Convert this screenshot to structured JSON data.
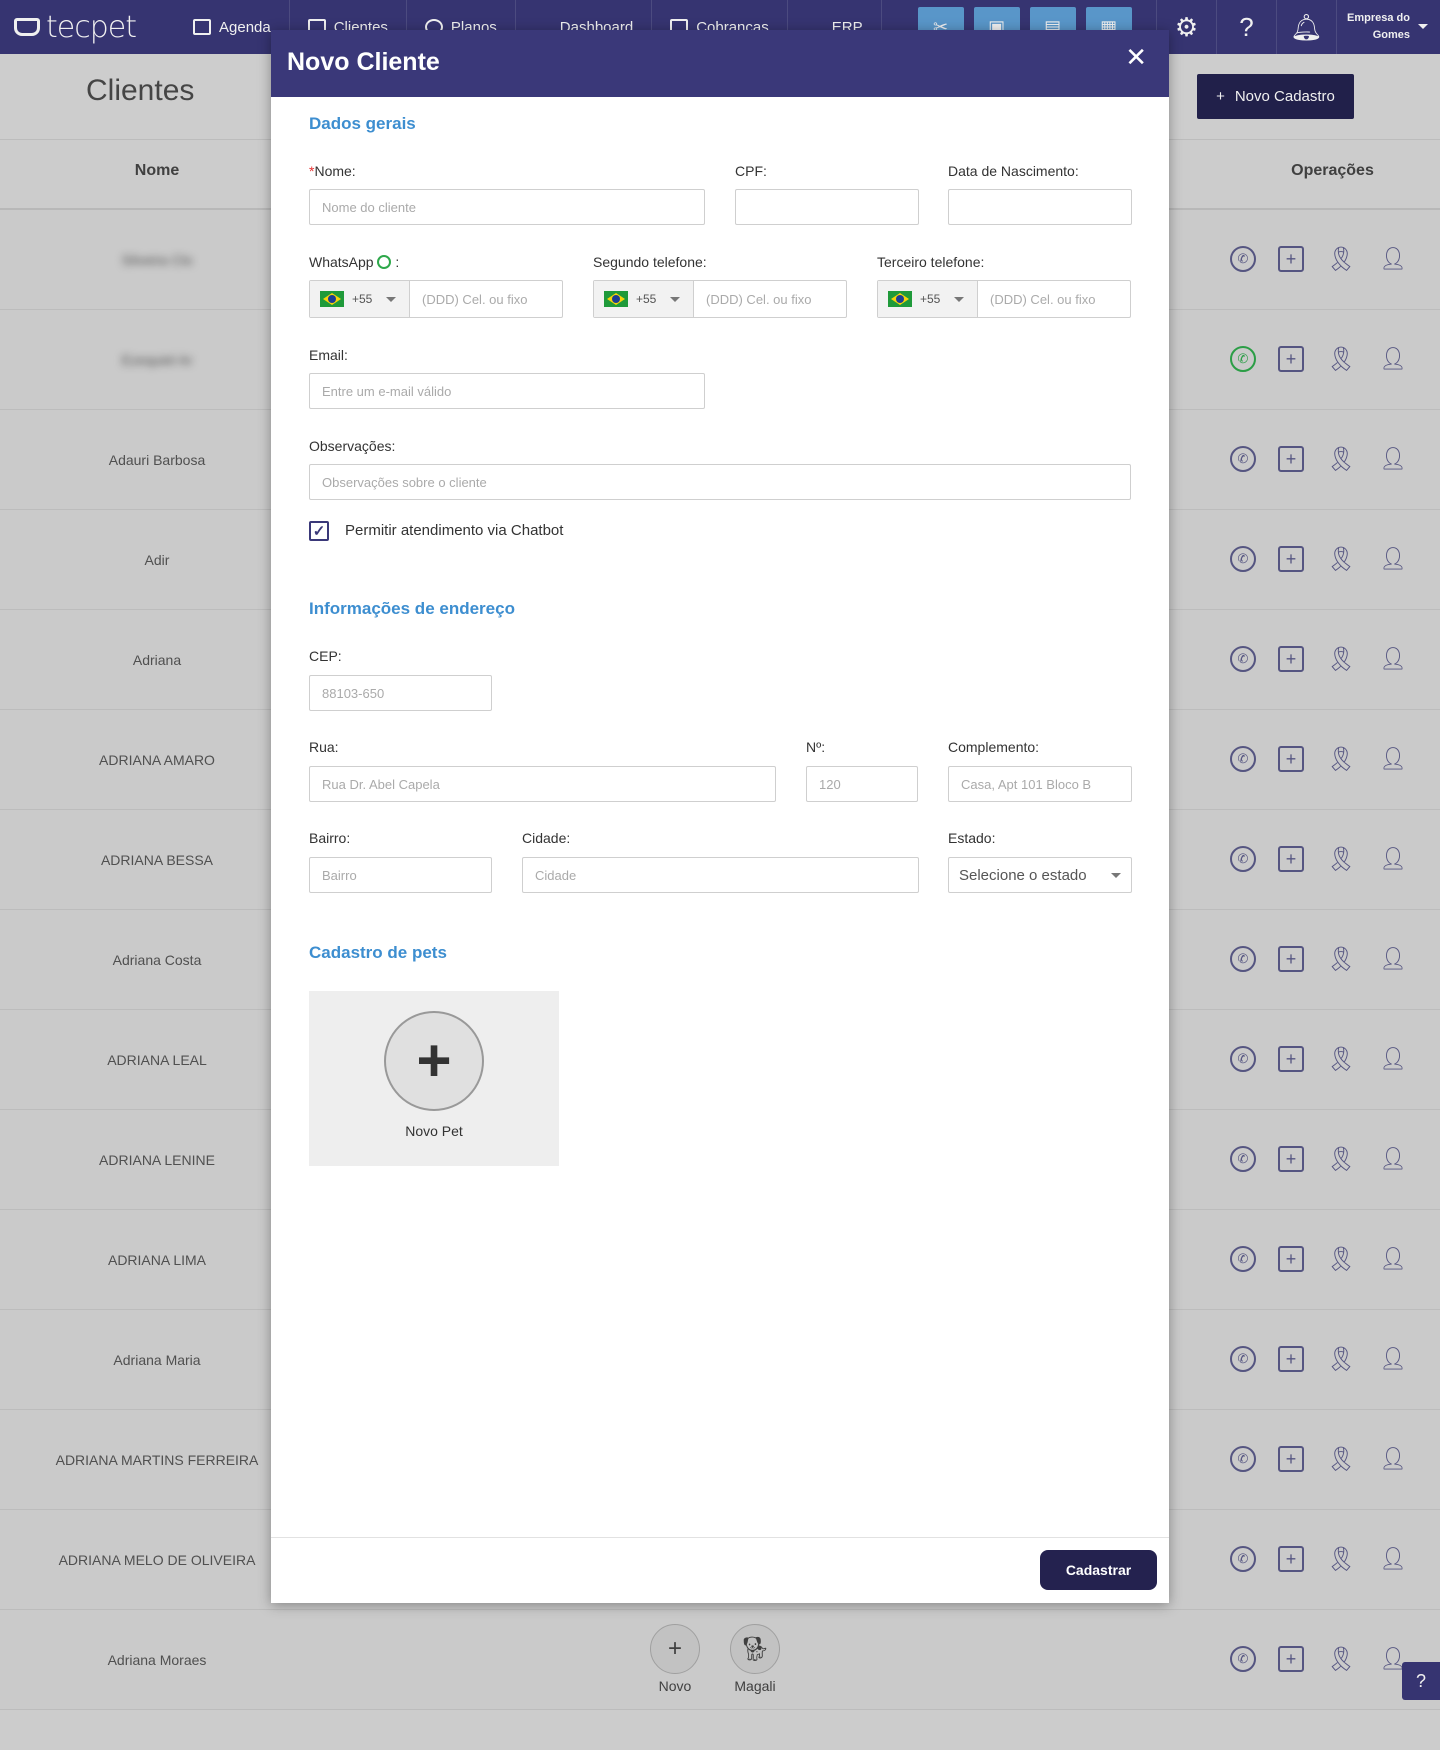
{
  "nav": {
    "logo": "tecpet",
    "items": [
      {
        "label": "Agenda",
        "icon": "calendar-icon"
      },
      {
        "label": "Clientes",
        "icon": "users-icon"
      },
      {
        "label": "Planos",
        "icon": "plans-icon"
      },
      {
        "label": "Dashboard",
        "icon": "chart-line-icon"
      },
      {
        "label": "Cobranças",
        "icon": "money-icon"
      },
      {
        "label": "ERP",
        "icon": "bar-chart-icon"
      }
    ],
    "quick_icons": [
      "scissors-icon",
      "bag-icon",
      "cash-register-icon",
      "calendar-icon"
    ],
    "company": "Empresa do Gomes"
  },
  "page": {
    "title": "Clientes",
    "new_button": "Novo Cadastro",
    "col_name": "Nome",
    "col_ops": "Operações",
    "rows": [
      {
        "name": "Silveira Clo"
      },
      {
        "name": "Ezequiel Ar"
      },
      {
        "name": "Adauri Barbosa"
      },
      {
        "name": "Adir"
      },
      {
        "name": "Adriana"
      },
      {
        "name": "ADRIANA AMARO"
      },
      {
        "name": "ADRIANA BESSA"
      },
      {
        "name": "Adriana Costa"
      },
      {
        "name": "ADRIANA LEAL"
      },
      {
        "name": "ADRIANA LENINE"
      },
      {
        "name": "ADRIANA LIMA"
      },
      {
        "name": "Adriana Maria"
      },
      {
        "name": "ADRIANA MARTINS FERREIRA"
      },
      {
        "name": "ADRIANA MELO DE OLIVEIRA"
      },
      {
        "name": "Adriana Moraes"
      }
    ],
    "pet_buttons": [
      {
        "label": "Novo"
      },
      {
        "label": "Magali"
      }
    ]
  },
  "modal": {
    "title": "Novo Cliente",
    "section_general": "Dados gerais",
    "name_label": "Nome:",
    "name_required": "*",
    "name_placeholder": "Nome do cliente",
    "cpf_label": "CPF:",
    "birth_label": "Data de Nascimento:",
    "whatsapp_label": "WhatsApp",
    "whatsapp_suffix": ":",
    "second_phone_label": "Segundo telefone:",
    "third_phone_label": "Terceiro telefone:",
    "country_code": "+55",
    "phone_placeholder": "(DDD) Cel. ou fixo",
    "email_label": "Email:",
    "email_placeholder": "Entre um e-mail válido",
    "notes_label": "Observações:",
    "notes_placeholder": "Observações sobre o cliente",
    "chatbot_label": "Permitir atendimento via Chatbot",
    "section_address": "Informações de endereço",
    "cep_label": "CEP:",
    "cep_placeholder": "88103-650",
    "street_label": "Rua:",
    "street_placeholder": "Rua Dr. Abel Capela",
    "number_label": "Nº:",
    "number_placeholder": "120",
    "complement_label": "Complemento:",
    "complement_placeholder": "Casa, Apt 101 Bloco B",
    "district_label": "Bairro:",
    "district_placeholder": "Bairro",
    "city_label": "Cidade:",
    "city_placeholder": "Cidade",
    "state_label": "Estado:",
    "state_placeholder": "Selecione o estado",
    "section_pets": "Cadastro de pets",
    "new_pet": "Novo Pet",
    "submit": "Cadastrar"
  }
}
